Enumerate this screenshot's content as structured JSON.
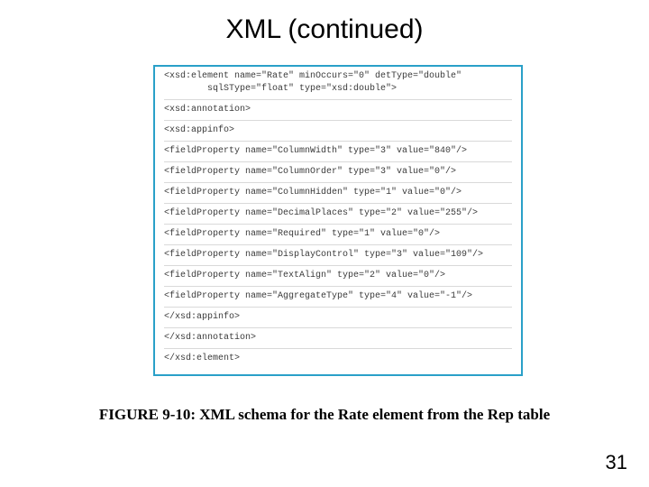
{
  "title": "XML (continued)",
  "code": {
    "line1": "<xsd:element name=\"Rate\" minOccurs=\"0\" detType=\"double\"",
    "line1b": "sqlSType=\"float\" type=\"xsd:double\">",
    "line2": "<xsd:annotation>",
    "line3": "<xsd:appinfo>",
    "line4": "<fieldProperty name=\"ColumnWidth\" type=\"3\" value=\"840\"/>",
    "line5": "<fieldProperty name=\"ColumnOrder\" type=\"3\" value=\"0\"/>",
    "line6": "<fieldProperty name=\"ColumnHidden\" type=\"1\" value=\"0\"/>",
    "line7": "<fieldProperty name=\"DecimalPlaces\" type=\"2\" value=\"255\"/>",
    "line8": "<fieldProperty name=\"Required\" type=\"1\" value=\"0\"/>",
    "line9": "<fieldProperty name=\"DisplayControl\" type=\"3\" value=\"109\"/>",
    "line10": "<fieldProperty name=\"TextAlign\" type=\"2\" value=\"0\"/>",
    "line11": "<fieldProperty name=\"AggregateType\" type=\"4\" value=\"-1\"/>",
    "line12": "</xsd:appinfo>",
    "line13": "</xsd:annotation>",
    "line14": "</xsd:element>"
  },
  "caption": "FIGURE 9-10: XML schema for the Rate element from the Rep table",
  "page_number": "31"
}
